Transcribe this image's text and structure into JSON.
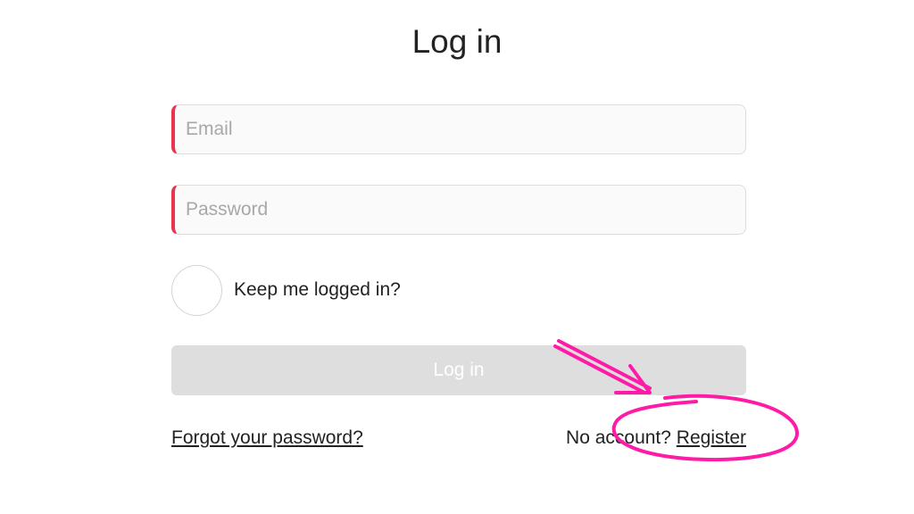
{
  "title": "Log in",
  "form": {
    "email_placeholder": "Email",
    "password_placeholder": "Password",
    "keep_logged_in_label": "Keep me logged in?",
    "keep_logged_in_checked": false,
    "login_button_label": "Log in"
  },
  "footer": {
    "forgot_password_label": "Forgot your password?",
    "no_account_text": "No account?",
    "register_label": "Register"
  },
  "colors": {
    "field_accent": "#e8344e",
    "button_disabled_bg": "#dedede",
    "annotation": "#ff1aa8"
  },
  "annotation": {
    "shapes": [
      "arrow-icon",
      "circle-highlight"
    ]
  }
}
